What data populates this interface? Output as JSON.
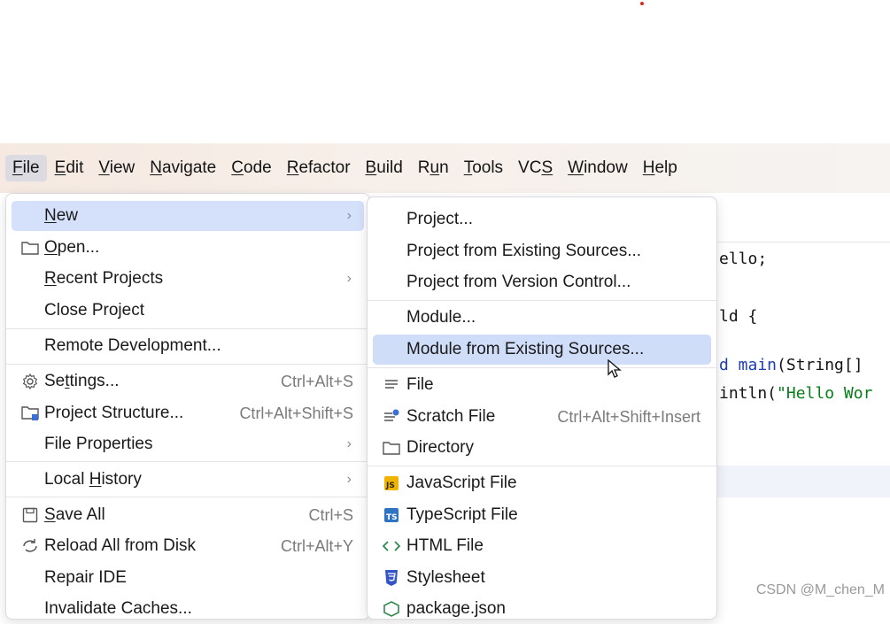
{
  "menubar": {
    "items": [
      "File",
      "Edit",
      "View",
      "Navigate",
      "Code",
      "Refactor",
      "Build",
      "Run",
      "Tools",
      "VCS",
      "Window",
      "Help"
    ],
    "mnemonics": [
      "F",
      "E",
      "V",
      "N",
      "C",
      "R",
      "B",
      "u",
      "T",
      "S",
      "W",
      "H"
    ]
  },
  "editor": {
    "lines": [
      "ello;",
      "ld {",
      "d main(String[]",
      "intln(\"Hello Wor"
    ]
  },
  "file_menu": {
    "new": "New",
    "open": "Open...",
    "recent_projects": "Recent Projects",
    "close_project": "Close Project",
    "remote_development": "Remote Development...",
    "settings": "Settings...",
    "settings_shortcut": "Ctrl+Alt+S",
    "project_structure": "Project Structure...",
    "project_structure_shortcut": "Ctrl+Alt+Shift+S",
    "file_properties": "File Properties",
    "local_history": "Local History",
    "save_all": "Save All",
    "save_all_shortcut": "Ctrl+S",
    "reload_all": "Reload All from Disk",
    "reload_all_shortcut": "Ctrl+Alt+Y",
    "repair_ide": "Repair IDE",
    "invalidate_caches": "Invalidate Caches..."
  },
  "new_submenu": {
    "project": "Project...",
    "project_existing": "Project from Existing Sources...",
    "project_vcs": "Project from Version Control...",
    "module": "Module...",
    "module_existing": "Module from Existing Sources...",
    "file": "File",
    "scratch_file": "Scratch File",
    "scratch_file_shortcut": "Ctrl+Alt+Shift+Insert",
    "directory": "Directory",
    "javascript_file": "JavaScript File",
    "typescript_file": "TypeScript File",
    "html_file": "HTML File",
    "stylesheet": "Stylesheet",
    "package_json": "package.json"
  },
  "watermark": "CSDN @M_chen_M",
  "colors": {
    "selection": "#d5e1fb",
    "menubar_bg": "#f6ede7",
    "js_badge": "#f0b400",
    "ts_badge": "#2f74c0",
    "html_icon": "#2f8a4e",
    "css_icon": "#3356c4"
  }
}
